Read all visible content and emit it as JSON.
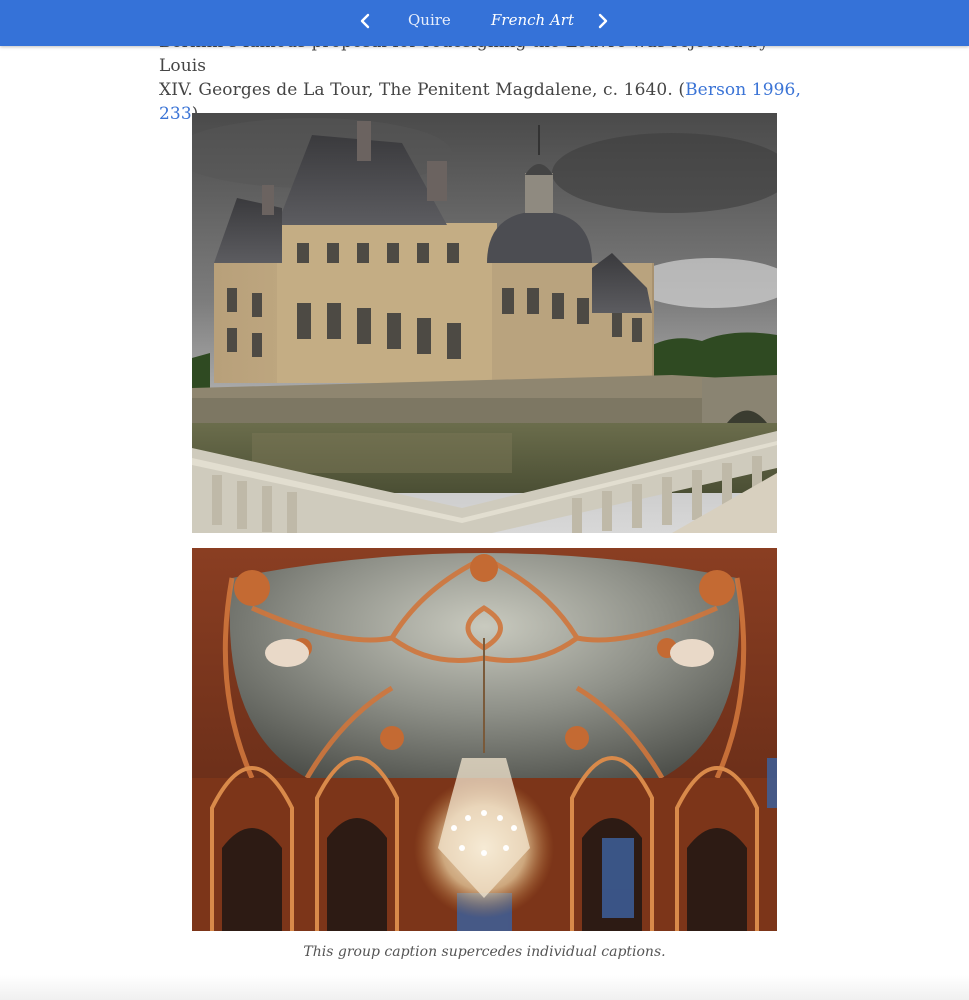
{
  "header": {
    "home_label": "Quire",
    "current_label": "French Art",
    "prev_icon": "chevron-left-icon",
    "next_icon": "chevron-right-icon",
    "bar_color": "#3572d8"
  },
  "content": {
    "text_line1": "Bernini’s famous proposal for redesigning the Louvre was rejected by Louis",
    "text_line2_before": "XIV. Georges de La Tour, The Penitent Magdalene, c. 1640. (",
    "citation_link": "Berson 1996, 233",
    "text_line2_after": ")",
    "link_color": "#3b74d6"
  },
  "figures": {
    "caption": "This group caption supercedes individual captions."
  }
}
